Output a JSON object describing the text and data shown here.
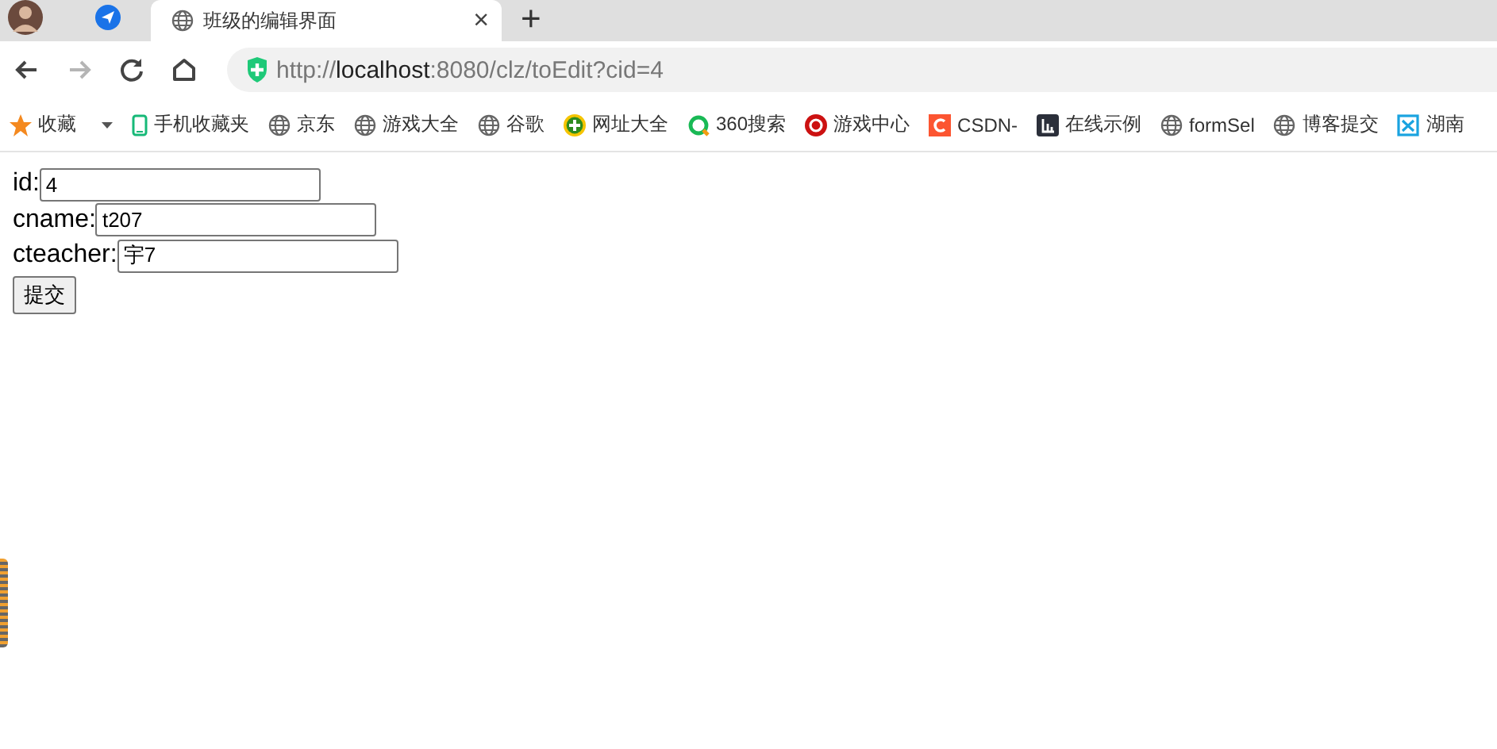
{
  "tab_bar": {
    "tabs": [
      {
        "title": "班级的编辑界面",
        "selected": true,
        "close": "×"
      }
    ],
    "new_tab": "+"
  },
  "toolbar": {
    "buttons": [
      {
        "kind": "back",
        "disabled": false
      },
      {
        "kind": "forward",
        "disabled": true
      },
      {
        "kind": "reload",
        "disabled": false
      },
      {
        "kind": "home",
        "disabled": false
      }
    ],
    "url": {
      "scheme": "http://",
      "host": "localhost",
      "path": ":8080/clz/toEdit?cid=4"
    }
  },
  "bookmarks": [
    {
      "label": "收藏",
      "kind": "star"
    },
    {
      "label": "手机收藏夹",
      "kind": "phone"
    },
    {
      "label": "京东",
      "kind": "globe"
    },
    {
      "label": "游戏大全",
      "kind": "globe"
    },
    {
      "label": "谷歌",
      "kind": "globe"
    },
    {
      "label": "网址大全",
      "kind": "plus"
    },
    {
      "label": "360搜索",
      "kind": "ring"
    },
    {
      "label": "游戏中心",
      "kind": "g"
    },
    {
      "label": "CSDN-",
      "kind": "c"
    },
    {
      "label": "在线示例",
      "kind": "dark"
    },
    {
      "label": "formSel",
      "kind": "globe"
    },
    {
      "label": "博客提交",
      "kind": "globe"
    },
    {
      "label": "湖南",
      "kind": "blue"
    }
  ],
  "form": {
    "fields": [
      {
        "label": "id:",
        "value": "4"
      },
      {
        "label": "cname:",
        "value": "t207"
      },
      {
        "label": "cteacher:",
        "value": "宇7"
      }
    ],
    "submit": "提交"
  }
}
